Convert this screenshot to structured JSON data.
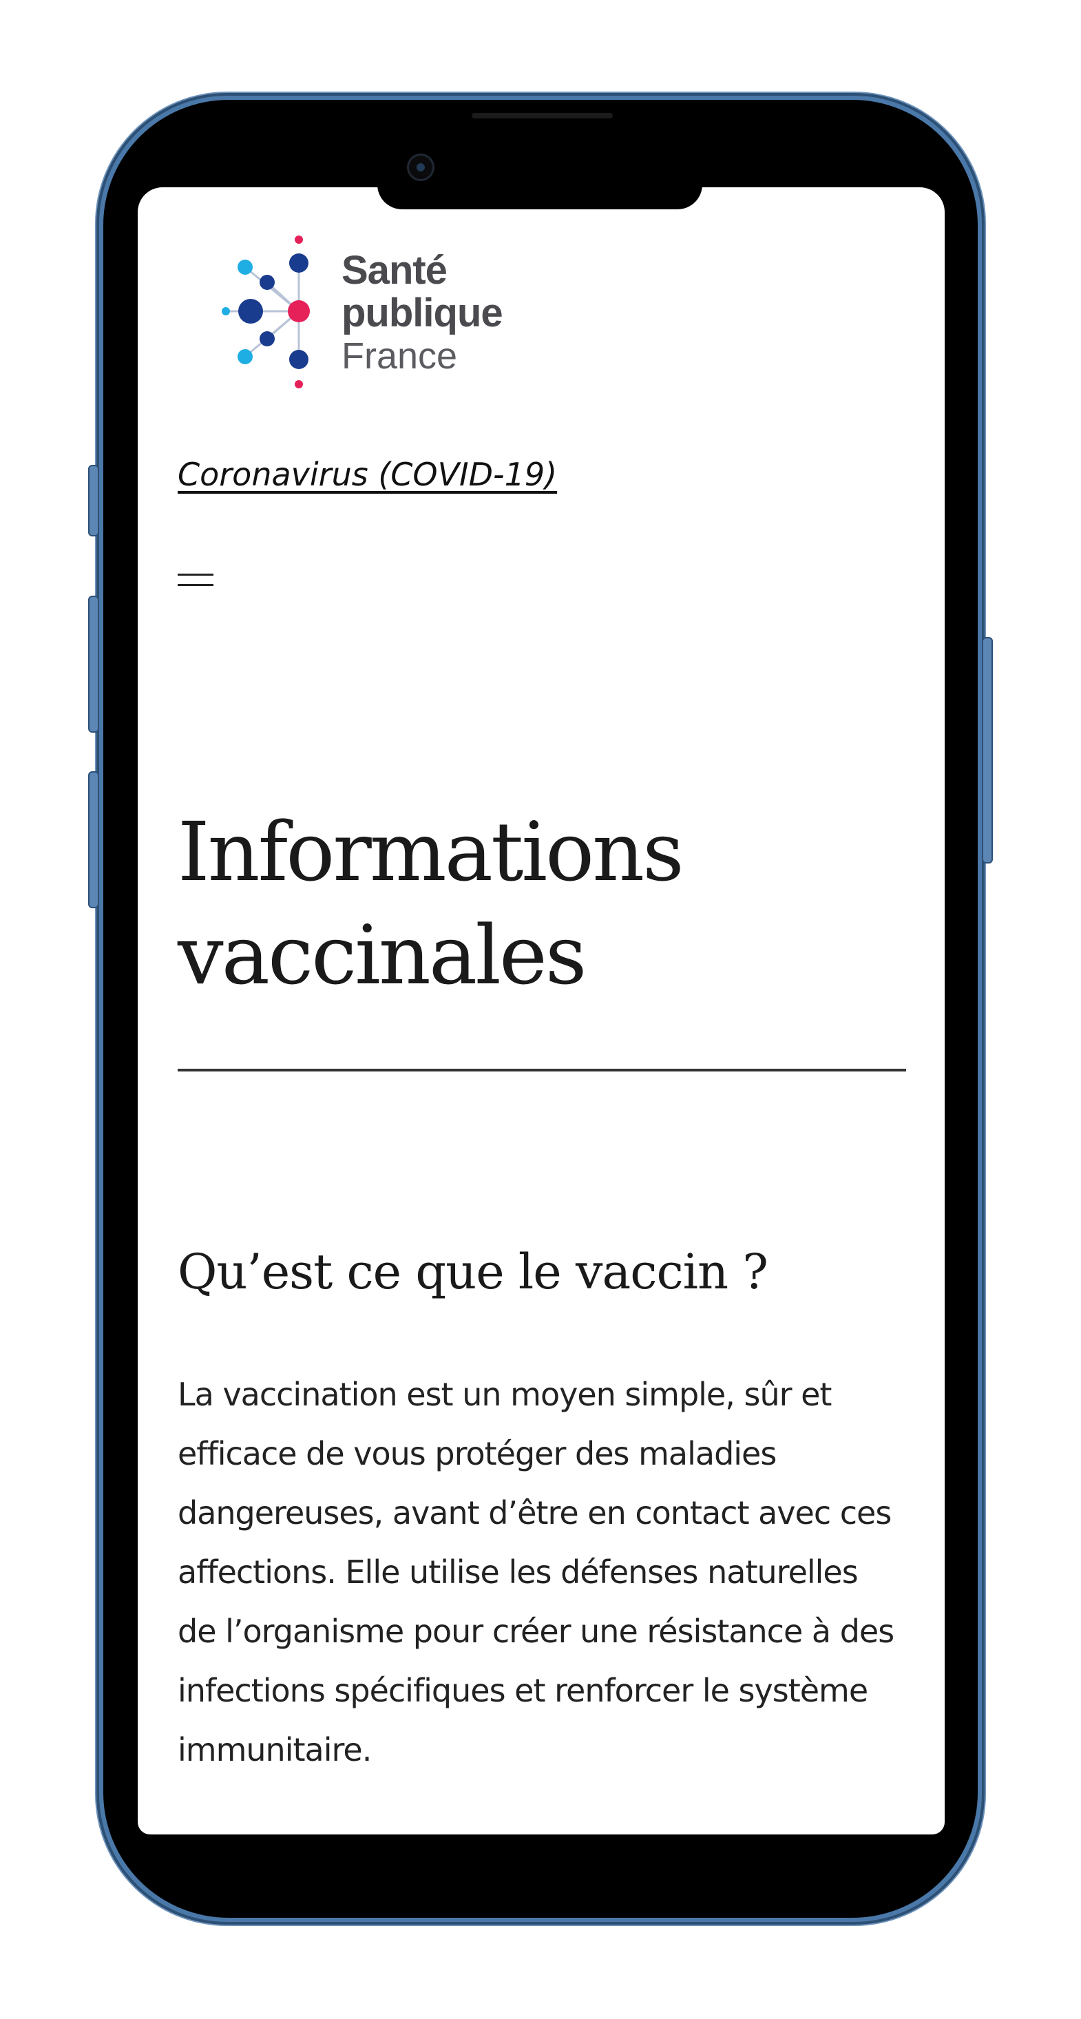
{
  "header": {
    "logo": {
      "line1": "Santé",
      "line2": "publique",
      "line3": "France"
    },
    "topic_link": "Coronavirus (COVID-19)",
    "menu_icon": "hamburger-menu-icon"
  },
  "main": {
    "title": "Informations vaccinales",
    "section": {
      "heading": "Qu’est ce que le vaccin ?",
      "body": "La vaccination est un moyen simple, sûr et efficace de vous protéger des maladies dangereuses, avant d’être en contact avec ces affections. Elle utilise les défenses naturelles de l’organisme pour créer une résistance à des infections spécifiques et renforcer le système immunitaire."
    }
  },
  "colors": {
    "phone_frame": "#4a78a9",
    "logo_dark_blue": "#1a3c8f",
    "logo_light_blue": "#1eaee3",
    "logo_pink": "#e6215a",
    "text": "#1a1a1a"
  }
}
